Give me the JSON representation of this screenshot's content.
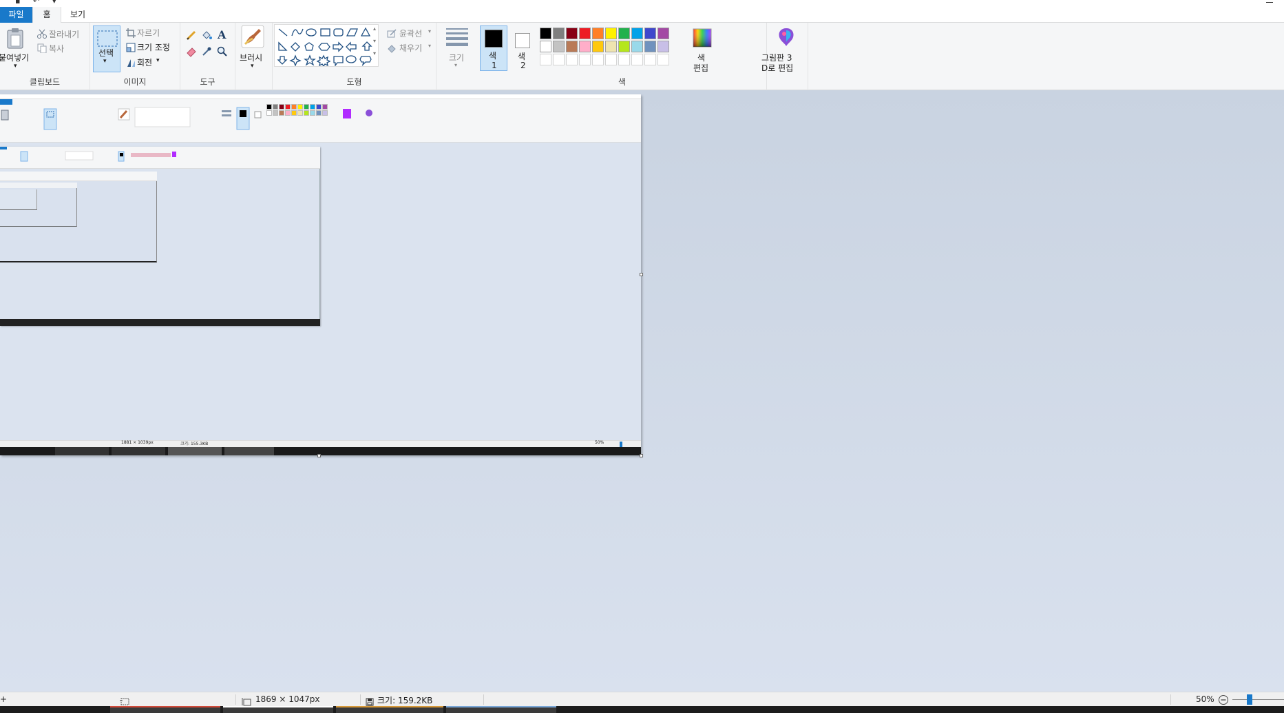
{
  "window": {
    "title": "",
    "min_icon": "minimize-icon"
  },
  "tabs": {
    "file": "파일",
    "home": "홈",
    "view": "보기"
  },
  "clipboard": {
    "paste": "붙여넣기",
    "cut": "잘라내기",
    "copy": "복사",
    "group": "클립보드"
  },
  "image": {
    "select": "선택",
    "crop": "자르기",
    "resize": "크기 조정",
    "rotate": "회전",
    "group": "이미지"
  },
  "tools": {
    "group": "도구",
    "text_glyph": "A"
  },
  "brushes": {
    "label": "브러시"
  },
  "shapes": {
    "outline": "윤곽선",
    "fill": "채우기",
    "group": "도형"
  },
  "size": {
    "label": "크기"
  },
  "colors": {
    "color1_line1": "색",
    "color1_line2": "1",
    "color2_line1": "색",
    "color2_line2": "2",
    "edit_line1": "색",
    "edit_line2": "편집",
    "group": "색",
    "palette_row1": [
      "#000000",
      "#7f7f7f",
      "#880015",
      "#ed1c24",
      "#ff7f27",
      "#fff200",
      "#22b14c",
      "#00a2e8",
      "#3f48cc",
      "#a349a4"
    ],
    "palette_row2": [
      "#ffffff",
      "#c3c3c3",
      "#b97a57",
      "#ffaec9",
      "#ffc90e",
      "#efe4b0",
      "#b5e61d",
      "#99d9ea",
      "#7092be",
      "#c8bfe7"
    ]
  },
  "paint3d": {
    "line1": "그림판 3",
    "line2": "D로 편집"
  },
  "status": {
    "dimensions": "1869 × 1047px",
    "size": "크기: 159.2KB",
    "zoom": "50%"
  },
  "nested": {
    "status_dims": "1881 × 1039px",
    "status_size": "크기: 155.3KB",
    "zoom": "50%"
  }
}
